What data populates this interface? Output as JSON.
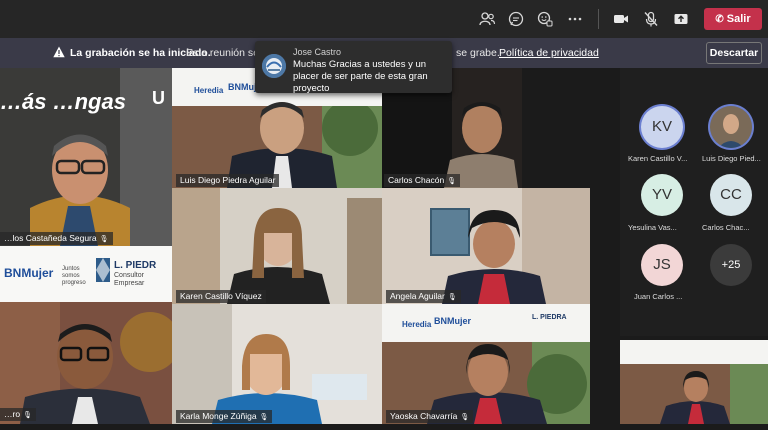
{
  "toolbar": {
    "leave_label": "Salir",
    "icons": [
      "people-icon",
      "chat-icon",
      "reactions-icon",
      "more-icon",
      "camera-icon",
      "mic-off-icon",
      "share-icon"
    ]
  },
  "banner": {
    "title": "La grabación se ha iniciado.",
    "text_before": "Esta reunión se es",
    "text_after": "se grabe.",
    "privacy_link": "Política de privacidad",
    "dismiss_label": "Descartar"
  },
  "toast": {
    "sender": "Jose Castro",
    "message": "Muchas Gracias a ustedes y un placer de ser parte de esta gran proyecto"
  },
  "participants": [
    {
      "name": "…ás …ngas",
      "label": "…los Castañeda Segura"
    },
    {
      "label": "Luis Diego Piedra Aguilar"
    },
    {
      "label": "Carlos Chacón"
    },
    {
      "label": "Karen Castillo Víquez"
    },
    {
      "label": "Angela Aguilar"
    },
    {
      "label": "…ro"
    },
    {
      "label": "Karla Monge Zúñiga"
    },
    {
      "label": "Yaoska Chavarría"
    }
  ],
  "overlays": {
    "heredia": "Heredia",
    "bnmujer": "BNMujer",
    "juntos": "Juntos somos progreso",
    "lpiedra": "L. PIEDRA",
    "consultores": "Consultores Empresarial",
    "lpiedra_partial": "L. PIEDR",
    "consultores_partial": "Consultor Empresar",
    "bn_partial": "BNMujer",
    "uni": "U"
  },
  "side_panel": {
    "people": [
      {
        "initials": "KV",
        "name": "Karen Castillo V...",
        "color": "#cbd5ee",
        "ring": "#6b7fd0"
      },
      {
        "initials": "",
        "name": "Luis Diego Pied...",
        "color": "#4e7ea8",
        "ring": "#6b7fd0"
      },
      {
        "initials": "YV",
        "name": "Yesulina Vas...",
        "color": "#d7eee4",
        "ring": ""
      },
      {
        "initials": "CC",
        "name": "Carlos Chac...",
        "color": "#d9e6ea",
        "ring": ""
      },
      {
        "initials": "JS",
        "name": "Juan Carlos ...",
        "color": "#f2d6d6",
        "ring": ""
      },
      {
        "initials": "+25",
        "name": "",
        "color": "#3b3b3b",
        "ring": ""
      }
    ]
  }
}
